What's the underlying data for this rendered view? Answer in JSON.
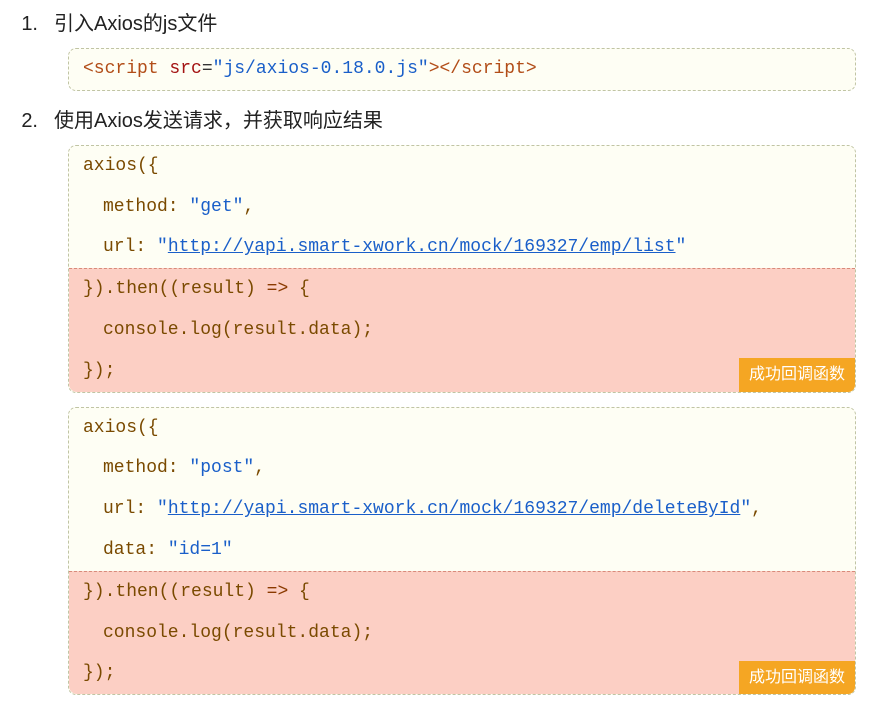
{
  "step1": {
    "num": "1.",
    "title": "引入Axios的js文件",
    "code": {
      "tag_open": "<script ",
      "attr": "src",
      "eq": "=",
      "attr_val": "\"js/axios-0.18.0.js\"",
      "tag_open_close": ">",
      "tag_close": "</script>"
    }
  },
  "step2": {
    "num": "2.",
    "title": "使用Axios发送请求，并获取响应结果",
    "block1": {
      "l1": "axios({",
      "l2_pre": "method: ",
      "l2_val": "\"get\"",
      "l2_post": ",",
      "l3_pre": "url: ",
      "l3_q1": "\"",
      "l3_url": "http://yapi.smart-xwork.cn/mock/169327/emp/list",
      "l3_q2": "\"",
      "l4_pre": "}).then((result) ",
      "l4_arrow": "=>",
      "l4_post": " {",
      "l5": "console.log(result.data);",
      "l6": "});",
      "badge": "成功回调函数"
    },
    "block2": {
      "l1": "axios({",
      "l2_pre": "method: ",
      "l2_val": "\"post\"",
      "l2_post": ",",
      "l3_pre": "url: ",
      "l3_q1": "\"",
      "l3_url": "http://yapi.smart-xwork.cn/mock/169327/emp/deleteById",
      "l3_q2": "\"",
      "l3_post": ",",
      "ld_pre": "data: ",
      "ld_val": "\"id=1\"",
      "l4_pre": "}).then((result) ",
      "l4_arrow": "=>",
      "l4_post": " {",
      "l5": "console.log(result.data);",
      "l6": "});",
      "badge": "成功回调函数"
    }
  }
}
